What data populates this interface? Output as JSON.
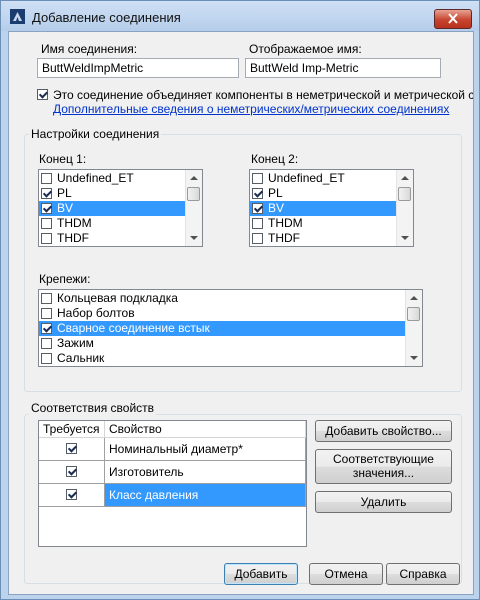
{
  "window": {
    "title": "Добавление соединения"
  },
  "connection_name": {
    "label": "Имя соединения:",
    "value": "ButtWeldImpMetric"
  },
  "display_name": {
    "label": "Отображаемое имя:",
    "value": "ButtWeld Imp-Metric"
  },
  "mixed_units": {
    "label": "Это соединение объединяет компоненты в неметрической и метрической систем",
    "checked": true
  },
  "more_info_link": "Дополнительные сведения о неметрических/метрических соединениях",
  "settings": {
    "group_label": "Настройки соединения",
    "end1": {
      "label": "Конец 1:",
      "items": [
        {
          "label": "Undefined_ET",
          "checked": false
        },
        {
          "label": "PL",
          "checked": true
        },
        {
          "label": "BV",
          "checked": true,
          "selected": true
        },
        {
          "label": "THDM",
          "checked": false
        },
        {
          "label": "THDF",
          "checked": false
        }
      ]
    },
    "end2": {
      "label": "Конец 2:",
      "items": [
        {
          "label": "Undefined_ET",
          "checked": false
        },
        {
          "label": "PL",
          "checked": true
        },
        {
          "label": "BV",
          "checked": true,
          "selected": true
        },
        {
          "label": "THDM",
          "checked": false
        },
        {
          "label": "THDF",
          "checked": false
        }
      ]
    },
    "fasteners": {
      "label": "Крепежи:",
      "items": [
        {
          "label": "Кольцевая подкладка",
          "checked": false
        },
        {
          "label": "Набор болтов",
          "checked": false
        },
        {
          "label": "Сварное соединение встык",
          "checked": true,
          "selected": true
        },
        {
          "label": "Зажим",
          "checked": false
        },
        {
          "label": "Сальник",
          "checked": false
        }
      ]
    }
  },
  "property_mapping": {
    "group_label": "Соответствия свойств",
    "columns": [
      "Требуется",
      "Свойство"
    ],
    "rows": [
      {
        "required": true,
        "property": "Номинальный диаметр*",
        "selected": false
      },
      {
        "required": true,
        "property": "Изготовитель",
        "selected": false
      },
      {
        "required": true,
        "property": "Класс давления",
        "selected": true
      }
    ],
    "add_property_button": "Добавить свойство...",
    "match_values_button": "Соответствующие значения...",
    "delete_button": "Удалить"
  },
  "footer": {
    "add": "Добавить",
    "cancel": "Отмена",
    "help": "Справка"
  }
}
